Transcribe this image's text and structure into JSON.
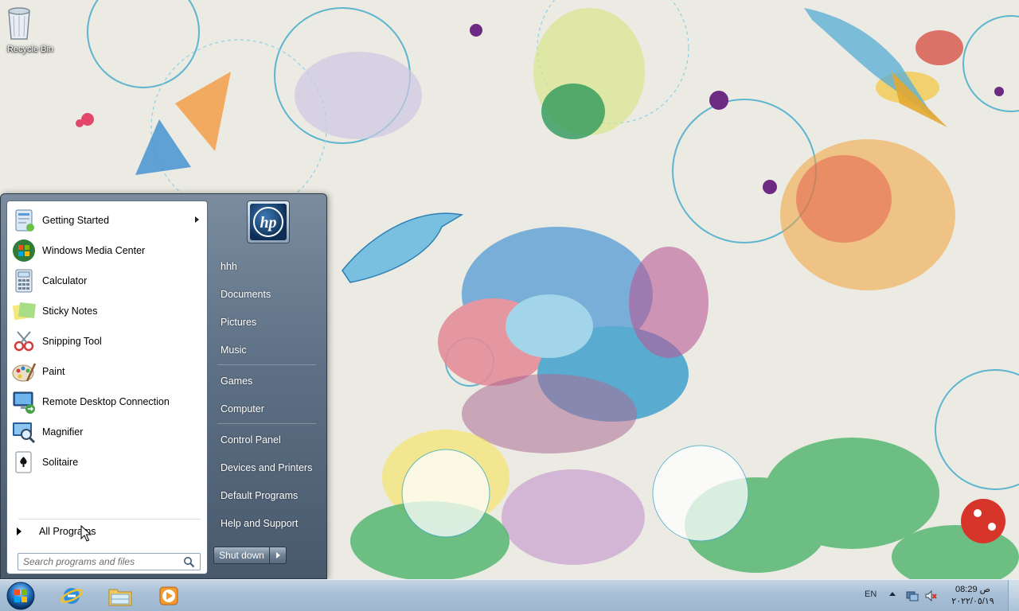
{
  "desktop": {
    "recycle_bin_label": "Recycle Bin"
  },
  "start_menu": {
    "pinned_items": [
      {
        "label": "Getting Started",
        "icon": "getting-started-icon",
        "has_submenu": true
      },
      {
        "label": "Windows Media Center",
        "icon": "windows-media-center-icon",
        "has_submenu": false
      },
      {
        "label": "Calculator",
        "icon": "calculator-icon",
        "has_submenu": false
      },
      {
        "label": "Sticky Notes",
        "icon": "sticky-notes-icon",
        "has_submenu": false
      },
      {
        "label": "Snipping Tool",
        "icon": "snipping-tool-icon",
        "has_submenu": false
      },
      {
        "label": "Paint",
        "icon": "paint-icon",
        "has_submenu": false
      },
      {
        "label": "Remote Desktop Connection",
        "icon": "remote-desktop-icon",
        "has_submenu": false
      },
      {
        "label": "Magnifier",
        "icon": "magnifier-icon",
        "has_submenu": false
      },
      {
        "label": "Solitaire",
        "icon": "solitaire-icon",
        "has_submenu": false
      }
    ],
    "all_programs_label": "All Programs",
    "search_placeholder": "Search programs and files",
    "user_picture": "hp",
    "right_links": [
      {
        "label": "hhh"
      },
      {
        "label": "Documents"
      },
      {
        "label": "Pictures"
      },
      {
        "label": "Music"
      },
      {
        "label": "Games"
      },
      {
        "label": "Computer"
      },
      {
        "label": "Control Panel"
      },
      {
        "label": "Devices and Printers"
      },
      {
        "label": "Default Programs"
      },
      {
        "label": "Help and Support"
      }
    ],
    "shutdown_label": "Shut down"
  },
  "taskbar": {
    "pinned": [
      {
        "name": "internet-explorer-icon"
      },
      {
        "name": "windows-explorer-icon"
      },
      {
        "name": "windows-media-player-icon"
      }
    ],
    "language": "EN",
    "clock_time": "08:29 ص",
    "clock_date": "٢٠٢٢/٠٥/١٩"
  },
  "colors": {
    "taskbar": "#a9c0d6",
    "start_menu_right": "#5e7085",
    "accent": "#1f6fbf"
  }
}
